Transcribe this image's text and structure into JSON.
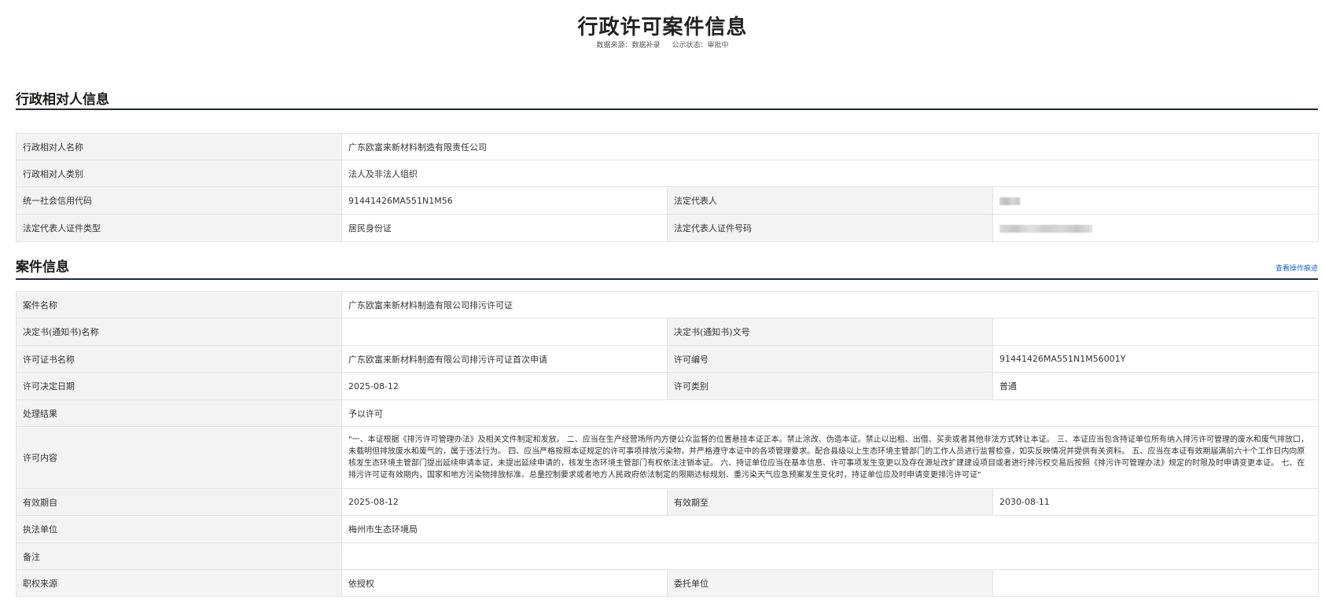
{
  "header": {
    "title": "行政许可案件信息",
    "source_label": "数据来源：数据补录",
    "status_label": "公示状态：审批中"
  },
  "party": {
    "section_title": "行政相对人信息",
    "rows": {
      "name_label": "行政相对人名称",
      "name_value": "广东欧富来新材料制造有限责任公司",
      "type_label": "行政相对人类别",
      "type_value": "法人及非法人组织",
      "credit_label": "统一社会信用代码",
      "credit_value": "91441426MA551N1M56",
      "rep_label": "法定代表人",
      "idtype_label": "法定代表人证件类型",
      "idtype_value": "居民身份证",
      "idno_label": "法定代表人证件号码"
    }
  },
  "case": {
    "section_title": "案件信息",
    "trace_link": "查看操作痕迹",
    "rows": {
      "case_name_label": "案件名称",
      "case_name_value": "广东欧富来新材料制造有限公司排污许可证",
      "decision_name_label": "决定书(通知书)名称",
      "decision_name_value": "",
      "decision_no_label": "决定书(通知书)文号",
      "decision_no_value": "",
      "license_name_label": "许可证书名称",
      "license_name_value": "广东欧富来新材料制造有限公司排污许可证首次申请",
      "license_no_label": "许可编号",
      "license_no_value": "91441426MA551N1M56001Y",
      "decision_date_label": "许可决定日期",
      "decision_date_value": "2025-08-12",
      "license_type_label": "许可类别",
      "license_type_value": "普通",
      "result_label": "处理结果",
      "result_value": "予以许可",
      "content_label": "许可内容",
      "content_value": "\"一、本证根据《排污许可管理办法》及相关文件制定和发放。 二、应当在生产经营场所内方便公众监督的位置悬挂本证正本。禁止涂改、伪造本证。禁止以出租、出借、买卖或者其他非法方式转让本证。 三、本证应当包含持证单位所有纳入排污许可管理的废水和废气排放口，未载明但排放废水和废气的，属于违法行为。 四、应当严格按照本证规定的许可事项排放污染物，并严格遵守本证中的各项管理要求。配合县级以上生态环境主管部门的工作人员进行监督检查，如实反映情况并提供有关资料。 五、应当在本证有效期届满前六十个工作日内向原核发生态环境主管部门提出延续申请本证，未提出延续申请的，核发生态环境主管部门有权依法注销本证。 六、持证单位应当在基本信息、许可事项发生变更以及存在源址改扩建建设项目或者进行排污权交易后按照《排污许可管理办法》规定的时限及时申请变更本证。 七、在排污许可证有效期内，国家和地方污染物排放标准、总量控制要求或者地方人民政府依法制定的限期达标规划、重污染天气应急预案发生变化时，持证单位应及时申请变更排污许可证\"",
      "valid_from_label": "有效期自",
      "valid_from_value": "2025-08-12",
      "valid_to_label": "有效期至",
      "valid_to_value": "2030-08-11",
      "agency_label": "执法单位",
      "agency_value": "梅州市生态环境局",
      "remark_label": "备注",
      "remark_value": "",
      "authority_label": "职权来源",
      "authority_value": "依授权",
      "entrust_label": "委托单位",
      "entrust_value": ""
    }
  }
}
